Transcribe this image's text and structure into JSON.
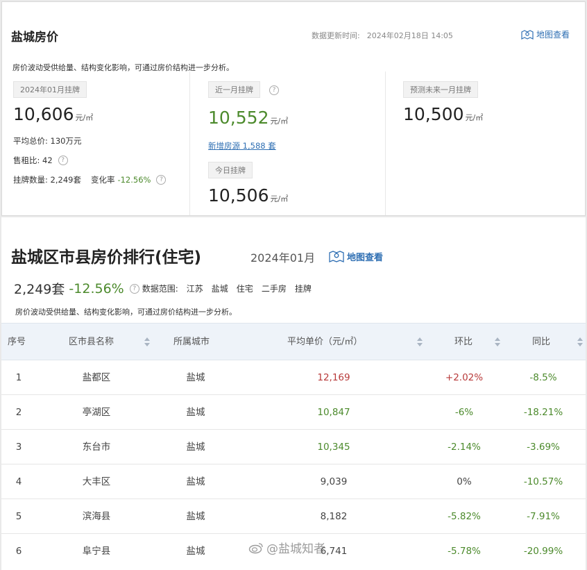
{
  "summary": {
    "title": "盐城房价",
    "update_label": "数据更新时间:",
    "update_time": "2024年02月18日 14:05",
    "map_link": "地图查看",
    "description": "房价波动受供给量、结构变化影响，可通过房价结构进一步分析。",
    "col1": {
      "tag": "2024年01月挂牌",
      "price": "10,606",
      "unit": "元/㎡",
      "total_label": "平均总价:",
      "total_value": "130万元",
      "rent_label": "售租比:",
      "rent_value": "42",
      "listings_label": "挂牌数量:",
      "listings_value": "2,249套",
      "change_label": "变化率",
      "change_value": "-12.56%"
    },
    "col2": {
      "tag": "近一月挂牌",
      "price": "10,552",
      "unit": "元/㎡",
      "new_listings": "新增房源 1,588 套",
      "today_tag": "今日挂牌",
      "today_price": "10,506",
      "today_unit": "元/㎡"
    },
    "col3": {
      "tag": "预测未来一月挂牌",
      "price": "10,500",
      "unit": "元/㎡"
    }
  },
  "ranking": {
    "title": "盐城区市县房价排行(住宅)",
    "period": "2024年01月",
    "map_link": "地图查看",
    "count": "2,249套",
    "change": "-12.56%",
    "scope_label": "数据范围:",
    "scope_items": [
      "江苏",
      "盐城",
      "住宅",
      "二手房",
      "挂牌"
    ],
    "description": "房价波动受供给量、结构变化影响，可通过房价结构进一步分析。",
    "columns": [
      "序号",
      "区市县名称",
      "所属城市",
      "平均单价（元/㎡）",
      "环比",
      "同比"
    ],
    "rows": [
      {
        "rank": "1",
        "name": "盐都区",
        "city": "盐城",
        "price": "12,169",
        "mom": "+2.02%",
        "yoy": "-8.5%"
      },
      {
        "rank": "2",
        "name": "亭湖区",
        "city": "盐城",
        "price": "10,847",
        "mom": "-6%",
        "yoy": "-18.21%"
      },
      {
        "rank": "3",
        "name": "东台市",
        "city": "盐城",
        "price": "10,345",
        "mom": "-2.14%",
        "yoy": "-3.69%"
      },
      {
        "rank": "4",
        "name": "大丰区",
        "city": "盐城",
        "price": "9,039",
        "mom": "0%",
        "yoy": "-10.57%"
      },
      {
        "rank": "5",
        "name": "滨海县",
        "city": "盐城",
        "price": "8,182",
        "mom": "-5.82%",
        "yoy": "-7.91%"
      },
      {
        "rank": "6",
        "name": "阜宁县",
        "city": "盐城",
        "price": "6,741",
        "mom": "-5.78%",
        "yoy": "-20.99%"
      }
    ]
  },
  "watermark": "@盐城知者",
  "colors": {
    "link": "#2f6fb3",
    "negative": "#4c8a2c",
    "positive": "#b83a3a",
    "header_bg": "#eef3f9"
  }
}
